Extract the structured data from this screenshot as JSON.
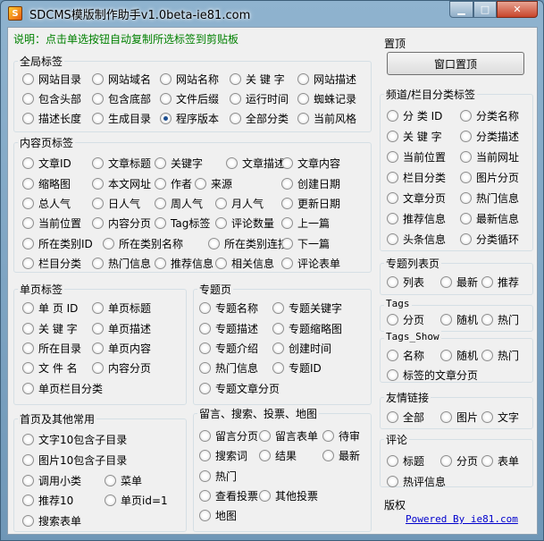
{
  "window": {
    "title": "SDCMS模版制作助手v1.0beta-ie81.com",
    "controls": {
      "minimize": "▁",
      "maximize": "□",
      "close": "✕"
    }
  },
  "hint": "说明：点击单选按钮自动复制所选标签到剪贴板",
  "global": {
    "title": "全局标签",
    "options": [
      "网站目录",
      "网站域名",
      "网站名称",
      "关 键 字",
      "网站描述",
      "包含头部",
      "包含底部",
      "文件后缀",
      "运行时间",
      "蜘蛛记录",
      "描述长度",
      "生成目录",
      "程序版本",
      "全部分类",
      "当前风格"
    ],
    "selected": "程序版本"
  },
  "content": {
    "title": "内容页标签",
    "options": [
      "文章ID",
      "文章标题",
      "关键字",
      "文章描述",
      "文章内容",
      "缩略图",
      "本文网址",
      "作者",
      "来源",
      "创建日期",
      "总人气",
      "日人气",
      "周人气",
      "月人气",
      "更新日期",
      "当前位置",
      "内容分页",
      "Tag标签",
      "评论数量",
      "上一篇",
      "所在类别ID",
      "所在类别名称",
      "所在类别连接",
      "下一篇",
      "栏目分类",
      "热门信息",
      "推荐信息",
      "相关信息",
      "评论表单"
    ]
  },
  "single": {
    "title": "单页标签",
    "options": [
      "单 页 ID",
      "单页标题",
      "关 键 字",
      "单页描述",
      "所在目录",
      "单页内容",
      "文 件 名",
      "内容分页",
      "单页栏目分类"
    ]
  },
  "topic": {
    "title": "专题页",
    "options": [
      "专题名称",
      "专题关键字",
      "专题描述",
      "专题缩略图",
      "专题介绍",
      "创建时间",
      "热门信息",
      "专题ID",
      "专题文章分页"
    ]
  },
  "home": {
    "title": "首页及其他常用",
    "options": [
      "文字10包含子目录",
      "图片10包含子目录",
      "调用小类",
      "菜单",
      "推荐10",
      "单页id=1",
      "搜索表单"
    ]
  },
  "misc": {
    "title": "留言、搜索、投票、地图",
    "options": [
      "留言分页",
      "留言表单",
      "待审",
      "搜索词",
      "结果",
      "最新",
      "热门",
      "查看投票",
      "其他投票",
      "地图"
    ]
  },
  "pin": {
    "title": "置顶",
    "button": "窗口置顶"
  },
  "channel": {
    "title": "频道/栏目分类标签",
    "options": [
      "分 类 ID",
      "分类名称",
      "关 键 字",
      "分类描述",
      "当前位置",
      "当前网址",
      "栏目分类",
      "图片分页",
      "文章分页",
      "热门信息",
      "推荐信息",
      "最新信息",
      "头条信息",
      "分类循环"
    ]
  },
  "topiclist": {
    "title": "专题列表页",
    "options": [
      "列表",
      "最新",
      "推荐"
    ]
  },
  "tags": {
    "title": "Tags",
    "options": [
      "分页",
      "随机",
      "热门"
    ]
  },
  "tagsshow": {
    "title": "Tags_Show",
    "options": [
      "名称",
      "随机",
      "热门",
      "标签的文章分页"
    ]
  },
  "friend": {
    "title": "友情链接",
    "options": [
      "全部",
      "图片",
      "文字"
    ]
  },
  "comment": {
    "title": "评论",
    "options": [
      "标题",
      "分页",
      "表单",
      "热评信息"
    ]
  },
  "copyright": {
    "title": "版权",
    "link": "Powered By ie81.com"
  }
}
